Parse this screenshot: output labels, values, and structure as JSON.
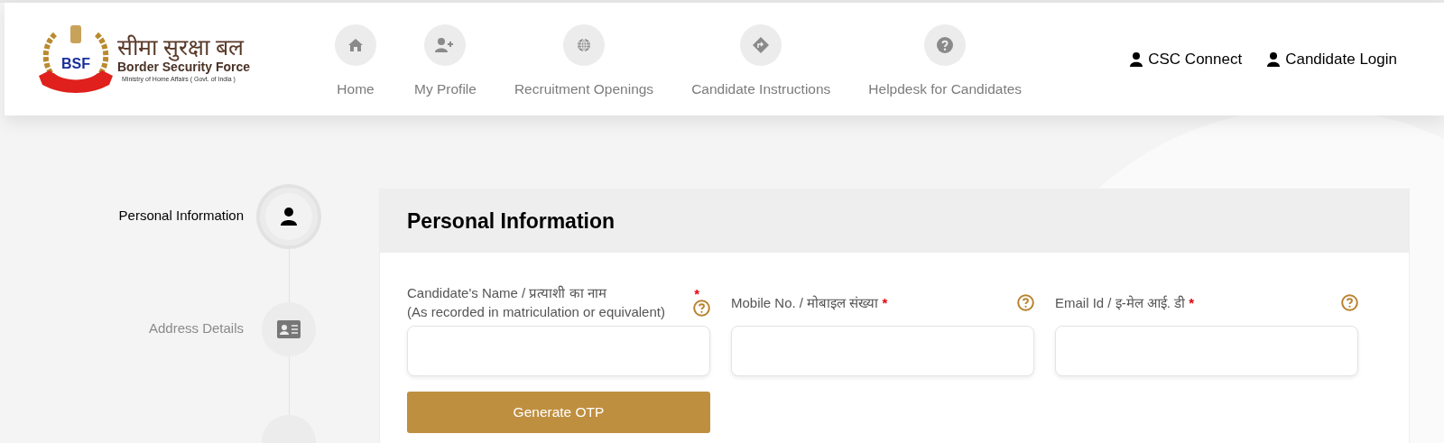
{
  "logo": {
    "hindi": "सीमा सुरक्षा बल",
    "name": "Border Security Force",
    "subtitle": "Ministry of Home Affairs ( Govt. of India )",
    "badge": "BSF"
  },
  "nav": [
    {
      "kind": "home",
      "label": "Home"
    },
    {
      "kind": "user-plus",
      "label": "My Profile"
    },
    {
      "kind": "globe",
      "label": "Recruitment Openings"
    },
    {
      "kind": "directions",
      "label": "Candidate Instructions"
    },
    {
      "kind": "help",
      "label": "Helpdesk for Candidates"
    }
  ],
  "account_links": [
    "CSC Connect",
    "Candidate Login"
  ],
  "steps": [
    {
      "kind": "person",
      "label": "Personal Information",
      "selected": true
    },
    {
      "kind": "id-card",
      "label": "Address Details",
      "selected": false
    },
    {
      "kind": "blank",
      "selected": false
    }
  ],
  "card": {
    "title": "Personal Information",
    "fields": [
      {
        "label": "Candidate's Name / प्रत्याशी का नाम",
        "sublabel": "(As recorded in matriculation or equivalent)",
        "mark": "*"
      },
      {
        "label": "Mobile No. / मोबाइल संख्या",
        "mark": "*"
      },
      {
        "label": "Email Id / इ-मेल आई. डी",
        "mark": "*"
      }
    ],
    "button": "Generate OTP"
  }
}
